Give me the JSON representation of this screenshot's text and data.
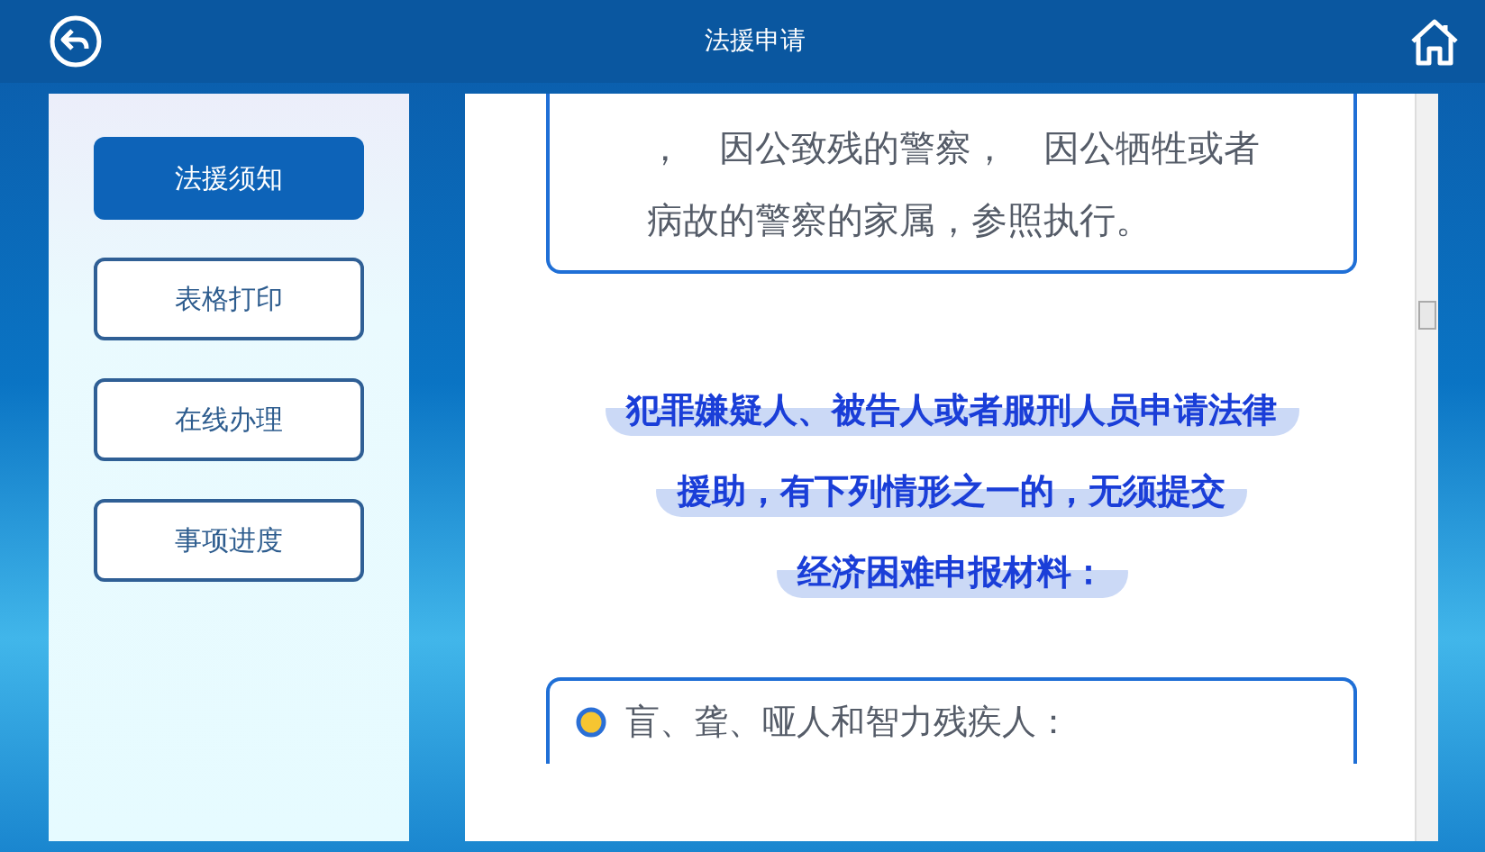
{
  "header": {
    "title": "法援申请"
  },
  "sidebar": {
    "items": [
      {
        "label": "法援须知",
        "selected": true
      },
      {
        "label": "表格打印",
        "selected": false
      },
      {
        "label": "在线办理",
        "selected": false
      },
      {
        "label": "事项进度",
        "selected": false
      }
    ]
  },
  "content": {
    "top_card": {
      "lines": [
        "，　因公致残的警察，　因公牺牲或者",
        "病故的警察的家属，参照执行。"
      ]
    },
    "heading_lines": [
      "犯罪嫌疑人、被告人或者服刑人员申请法律",
      "援助，有下列情形之一的，无须提交",
      "经济困难申报材料："
    ],
    "list_items": [
      "盲、聋、哑人和智力残疾人："
    ]
  }
}
